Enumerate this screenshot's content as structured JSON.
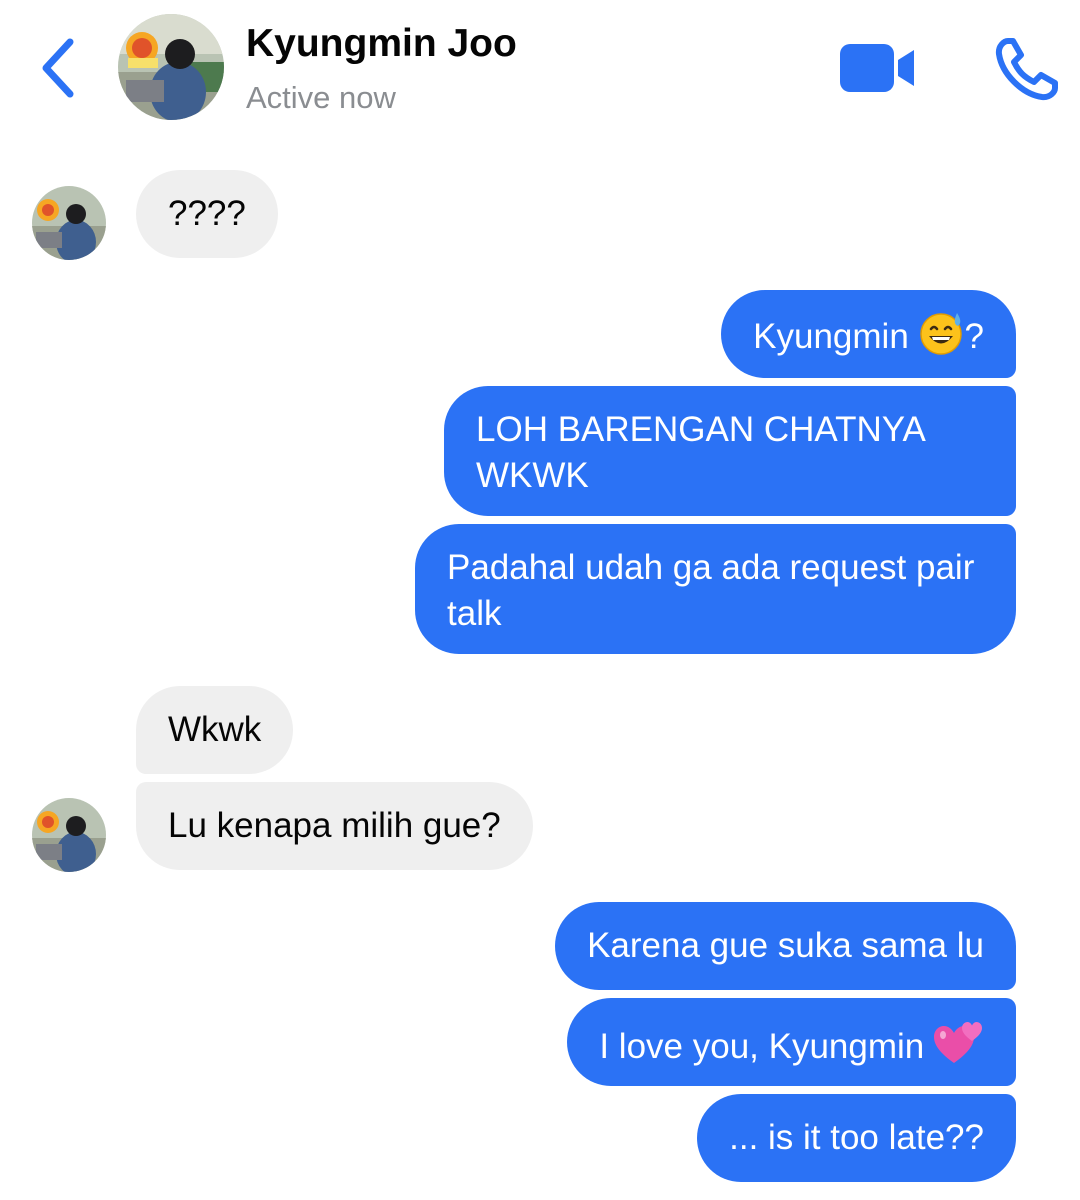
{
  "header": {
    "contact_name": "Kyungmin Joo",
    "status": "Active now",
    "back_icon": "chevron-left-icon",
    "video_icon": "video-camera-icon",
    "call_icon": "phone-icon",
    "accent_color": "#2b72f5"
  },
  "messages": [
    {
      "direction": "in",
      "text": "????"
    },
    {
      "direction": "out",
      "text": "Kyungmin",
      "trailing_text": "?",
      "emoji": "sweat-smile-emoji"
    },
    {
      "direction": "out",
      "text": "LOH BARENGAN CHATNYA WKWK"
    },
    {
      "direction": "out",
      "text": "Padahal udah ga ada request pair talk"
    },
    {
      "direction": "in",
      "text": "Wkwk"
    },
    {
      "direction": "in",
      "text": "Lu kenapa milih gue?"
    },
    {
      "direction": "out",
      "text": "Karena gue suka sama lu"
    },
    {
      "direction": "out",
      "text": "I love you, Kyungmin",
      "emoji": "two-hearts-emoji"
    },
    {
      "direction": "out",
      "text": "... is it too late??"
    }
  ],
  "colors": {
    "outgoing_bubble": "#2b72f5",
    "incoming_bubble": "#efefef",
    "status_text": "#8a8d91"
  }
}
